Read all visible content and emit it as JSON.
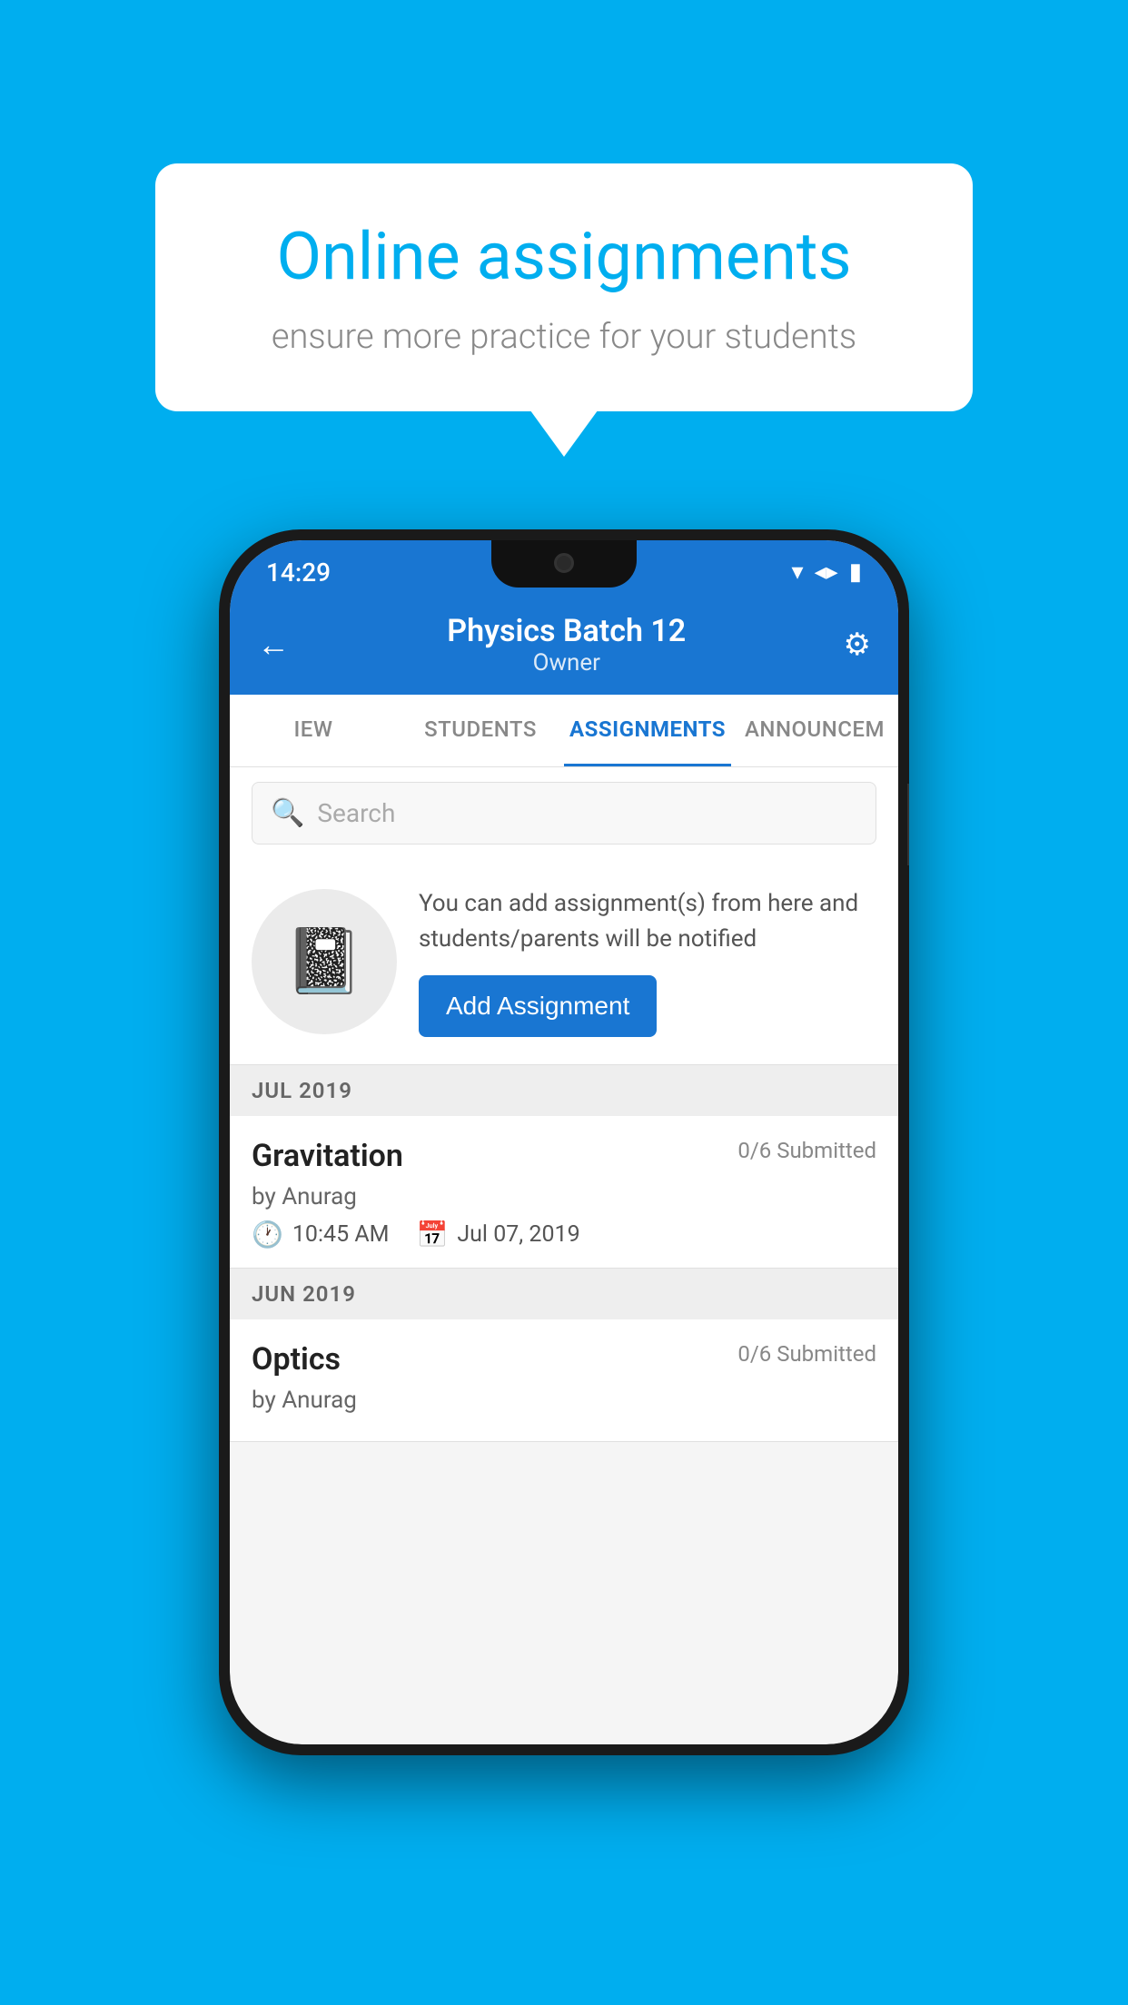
{
  "background_color": "#00AEEF",
  "promo": {
    "title": "Online assignments",
    "subtitle": "ensure more practice for your students"
  },
  "phone": {
    "status_bar": {
      "time": "14:29",
      "wifi_icon": "▾",
      "signal_icon": "◂▸",
      "battery_icon": "▮"
    },
    "header": {
      "title": "Physics Batch 12",
      "subtitle": "Owner",
      "back_icon": "←",
      "settings_icon": "⚙"
    },
    "tabs": [
      {
        "label": "IEW",
        "active": false
      },
      {
        "label": "STUDENTS",
        "active": false
      },
      {
        "label": "ASSIGNMENTS",
        "active": true
      },
      {
        "label": "ANNOUNCEM",
        "active": false
      }
    ],
    "search": {
      "placeholder": "Search"
    },
    "add_assignment": {
      "description": "You can add assignment(s) from here and students/parents will be notified",
      "button_label": "Add Assignment"
    },
    "assignments": [
      {
        "month_label": "JUL 2019",
        "items": [
          {
            "title": "Gravitation",
            "submitted": "0/6 Submitted",
            "by": "by Anurag",
            "time": "10:45 AM",
            "date": "Jul 07, 2019"
          }
        ]
      },
      {
        "month_label": "JUN 2019",
        "items": [
          {
            "title": "Optics",
            "submitted": "0/6 Submitted",
            "by": "by Anurag",
            "time": "",
            "date": ""
          }
        ]
      }
    ]
  }
}
